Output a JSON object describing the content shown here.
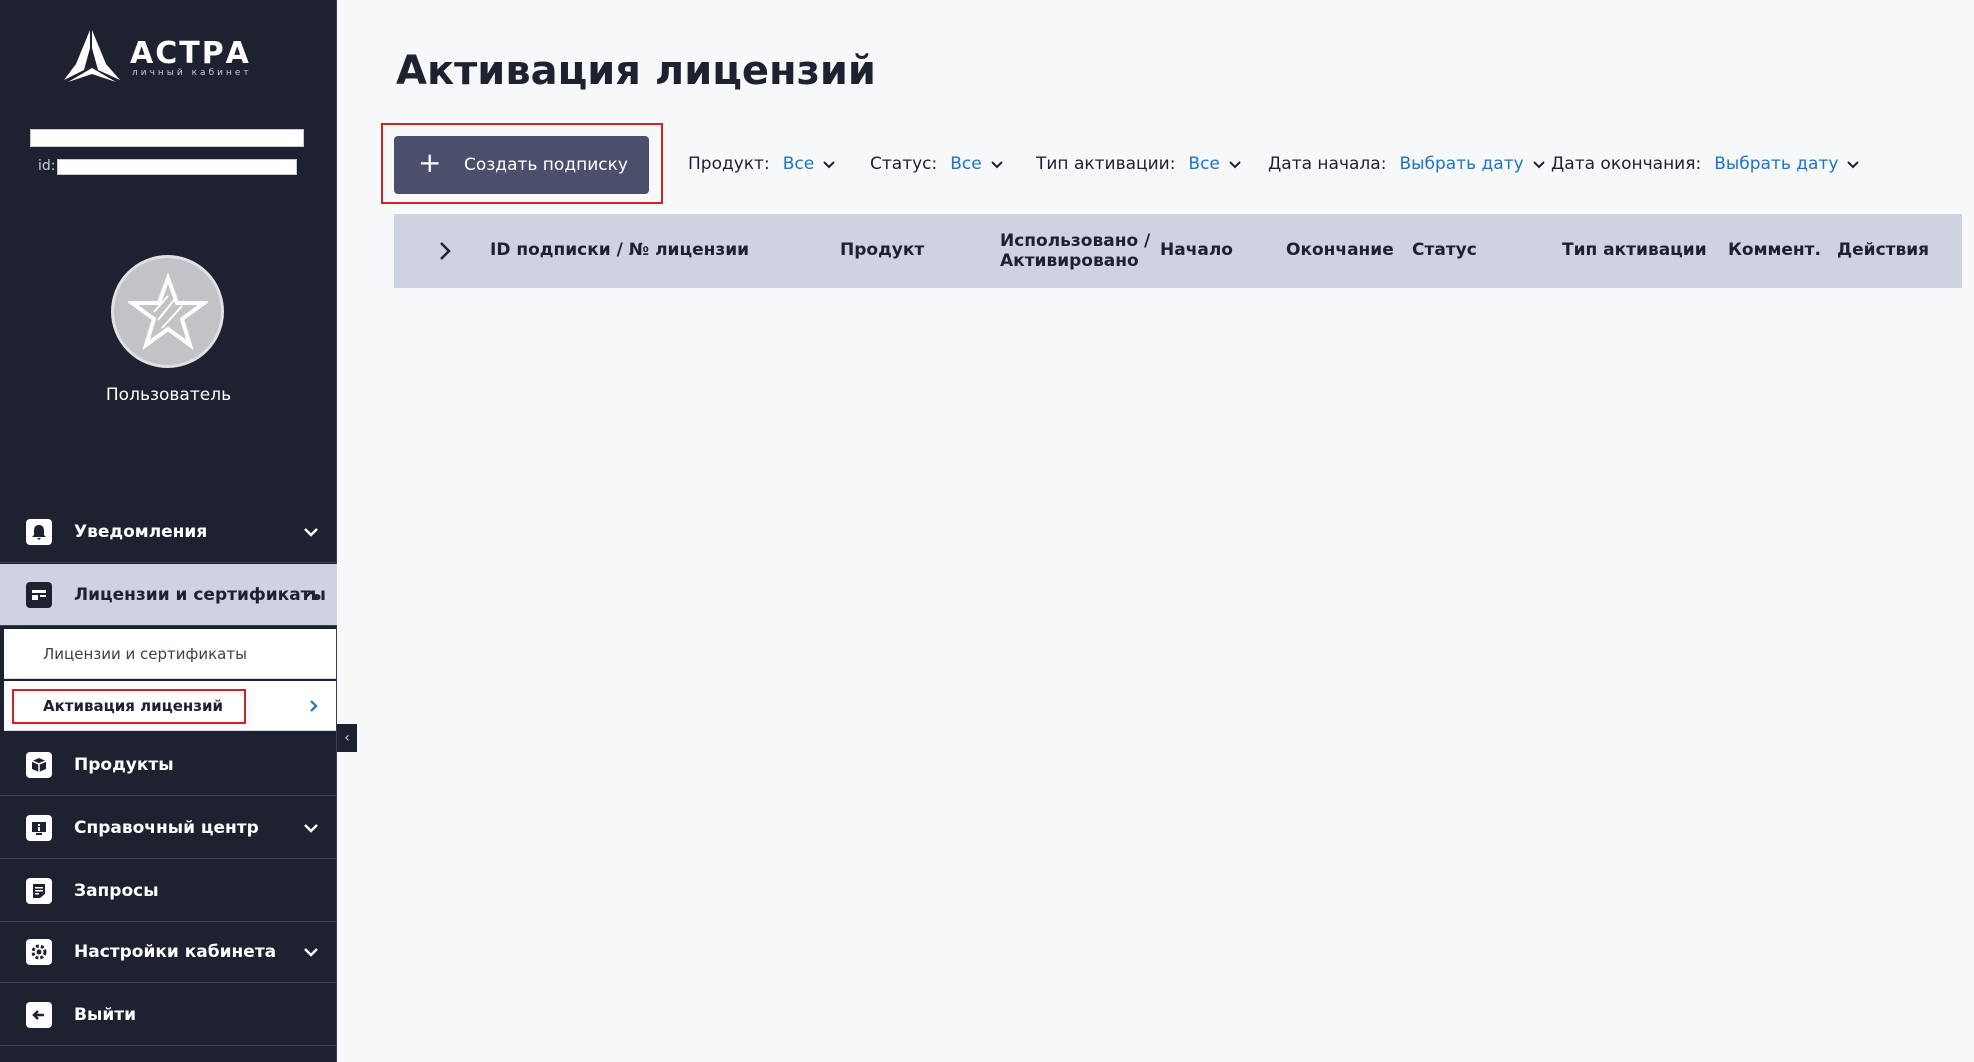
{
  "sidebar": {
    "logo_text": "АСТРА",
    "logo_sub": "личный кабинет",
    "id_label": "id:",
    "user_name": "Пользователь",
    "nav": {
      "notifications": "Уведомления",
      "licenses": "Лицензии и сертификаты",
      "products": "Продукты",
      "help_center": "Справочный центр",
      "requests": "Запросы",
      "settings": "Настройки кабинета",
      "logout": "Выйти"
    },
    "sub": {
      "licenses_certs": "Лицензии и сертификаты",
      "activation": "Активация лицензий"
    }
  },
  "main": {
    "title": "Активация лицензий",
    "create_button": "Создать подписку",
    "filters": {
      "product_label": "Продукт:",
      "product_value": "Все",
      "status_label": "Статус:",
      "status_value": "Все",
      "activation_type_label": "Тип активации:",
      "activation_type_value": "Все",
      "start_date_label": "Дата начала:",
      "start_date_value": "Выбрать дату",
      "end_date_label": "Дата окончания:",
      "end_date_value": "Выбрать дату"
    },
    "table": {
      "columns": {
        "id": "ID подписки / № лицензии",
        "product": "Продукт",
        "used_1": "Использовано /",
        "used_2": "Активировано",
        "start": "Начало",
        "end": "Окончание",
        "status": "Статус",
        "activation_type": "Тип активации",
        "comment": "Коммент.",
        "actions": "Действия"
      }
    }
  },
  "colors": {
    "sidebar_bg": "#1e2230",
    "accent_link": "#1e73c8",
    "button_bg": "#4b4f6b",
    "table_header_bg": "#cfd3df",
    "highlight_red": "#d32020"
  }
}
